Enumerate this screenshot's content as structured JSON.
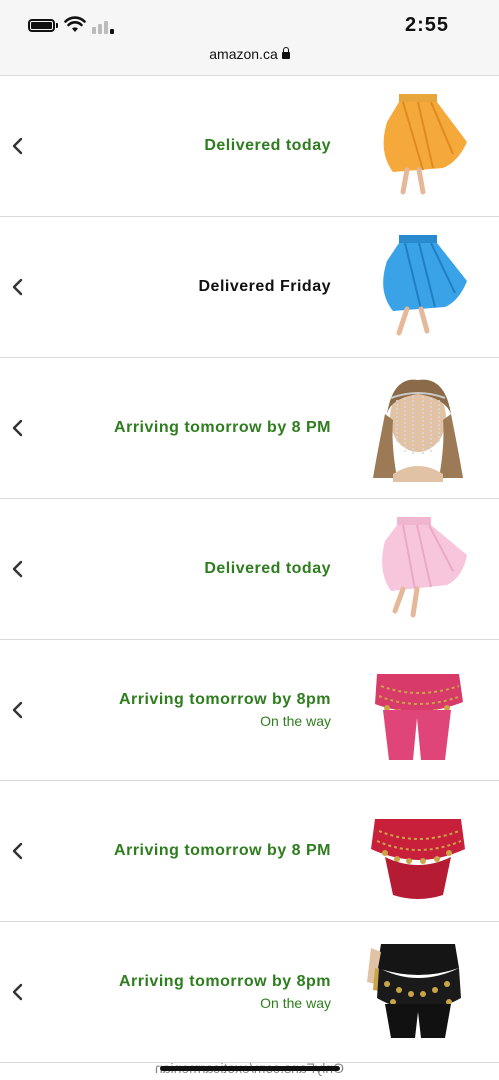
{
  "status_bar": {
    "time": "2:55",
    "address": "amazon.ca"
  },
  "orders": [
    {
      "status": "Delivered today",
      "status_color": "green",
      "subtext": "",
      "thumbnail": "orange-skirt-image"
    },
    {
      "status": "Delivered Friday",
      "status_color": "dark",
      "subtext": "",
      "thumbnail": "blue-skirt-image"
    },
    {
      "status": "Arriving tomorrow by 8 PM",
      "status_color": "green",
      "subtext": "",
      "thumbnail": "head-chain-image"
    },
    {
      "status": "Delivered today",
      "status_color": "green",
      "subtext": "",
      "thumbnail": "pink-skirt-image"
    },
    {
      "status": "Arriving tomorrow by 8pm",
      "status_color": "green",
      "subtext": "On the way",
      "thumbnail": "pink-coin-scarf-image"
    },
    {
      "status": "Arriving tomorrow by 8 PM",
      "status_color": "green",
      "subtext": "",
      "thumbnail": "red-coin-scarf-image"
    },
    {
      "status": "Arriving tomorrow by 8pm",
      "status_color": "green",
      "subtext": "On the way",
      "thumbnail": "black-coin-scarf-image"
    }
  ],
  "watermark": "OnlyFans.com/exoticarmenian",
  "colors": {
    "status_green": "#2e7d1e",
    "status_dark": "#111111",
    "divider": "#d9d9d9",
    "status_bar_bg": "#f6f6f6"
  }
}
